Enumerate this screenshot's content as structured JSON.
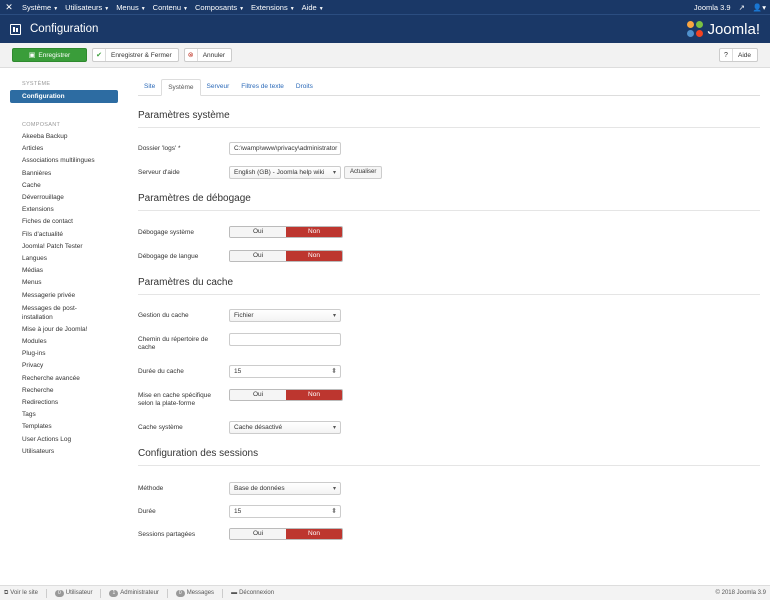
{
  "navbar": {
    "menus": [
      "Système",
      "Utilisateurs",
      "Menus",
      "Contenu",
      "Composants",
      "Extensions",
      "Aide"
    ],
    "version": "Joomla 3.9",
    "user_icon": "user-icon"
  },
  "header": {
    "title": "Configuration",
    "brand": "Joomla!"
  },
  "toolbar": {
    "save": "Enregistrer",
    "save_close": "Enregistrer & Fermer",
    "cancel": "Annuler",
    "help": "Aide"
  },
  "sidebar": {
    "system_heading": "SYSTÈME",
    "active_item": "Configuration",
    "component_heading": "COMPOSANT",
    "items": [
      "Akeeba Backup",
      "Articles",
      "Associations multilingues",
      "Bannières",
      "Cache",
      "Déverrouillage",
      "Extensions",
      "Fiches de contact",
      "Fils d'actualité",
      "Joomla! Patch Tester",
      "Langues",
      "Médias",
      "Menus",
      "Messagerie privée",
      "Messages de post-installation",
      "Mise à jour de Joomla!",
      "Modules",
      "Plug-ins",
      "Privacy",
      "Recherche avancée",
      "Recherche",
      "Redirections",
      "Tags",
      "Templates",
      "User Actions Log",
      "Utilisateurs"
    ]
  },
  "tabs": [
    "Site",
    "Système",
    "Serveur",
    "Filtres de texte",
    "Droits"
  ],
  "active_tab": "Système",
  "system": {
    "title": "Paramètres système",
    "logs_label": "Dossier 'logs' *",
    "logs_value": "C:\\wamp\\www\\privacy\\administrator",
    "help_label": "Serveur d'aide",
    "help_value": "English (GB) - Joomla help wiki",
    "refresh": "Actualiser"
  },
  "debug": {
    "title": "Paramètres de débogage",
    "system_label": "Débogage système",
    "language_label": "Débogage de langue"
  },
  "toggle": {
    "yes": "Oui",
    "no": "Non"
  },
  "cache": {
    "title": "Paramètres du cache",
    "handler_label": "Gestion du cache",
    "handler_value": "Fichier",
    "path_label": "Chemin du répertoire de cache",
    "path_value": "",
    "time_label": "Durée du cache",
    "time_value": "15",
    "platform_label": "Mise en cache spécifique selon la plate-forme",
    "system_label": "Cache système",
    "system_value": "Cache désactivé"
  },
  "session": {
    "title": "Configuration des sessions",
    "handler_label": "Méthode",
    "handler_value": "Base de données",
    "lifetime_label": "Durée",
    "lifetime_value": "15",
    "shared_label": "Sessions partagées"
  },
  "footer": {
    "view_site": "Voir le site",
    "visitors_count": "0",
    "visitors": "Utilisateur",
    "admins_count": "1",
    "admins": "Administrateur",
    "messages_count": "0",
    "messages": "Messages",
    "logout": "Déconnexion",
    "copyright": "© 2018 Joomla 3.9"
  },
  "colors": {
    "navbar": "#1a3867",
    "save": "#3a9d3a",
    "toggle_on": "#bd362f",
    "sidebar_active": "#2d6ca2"
  }
}
